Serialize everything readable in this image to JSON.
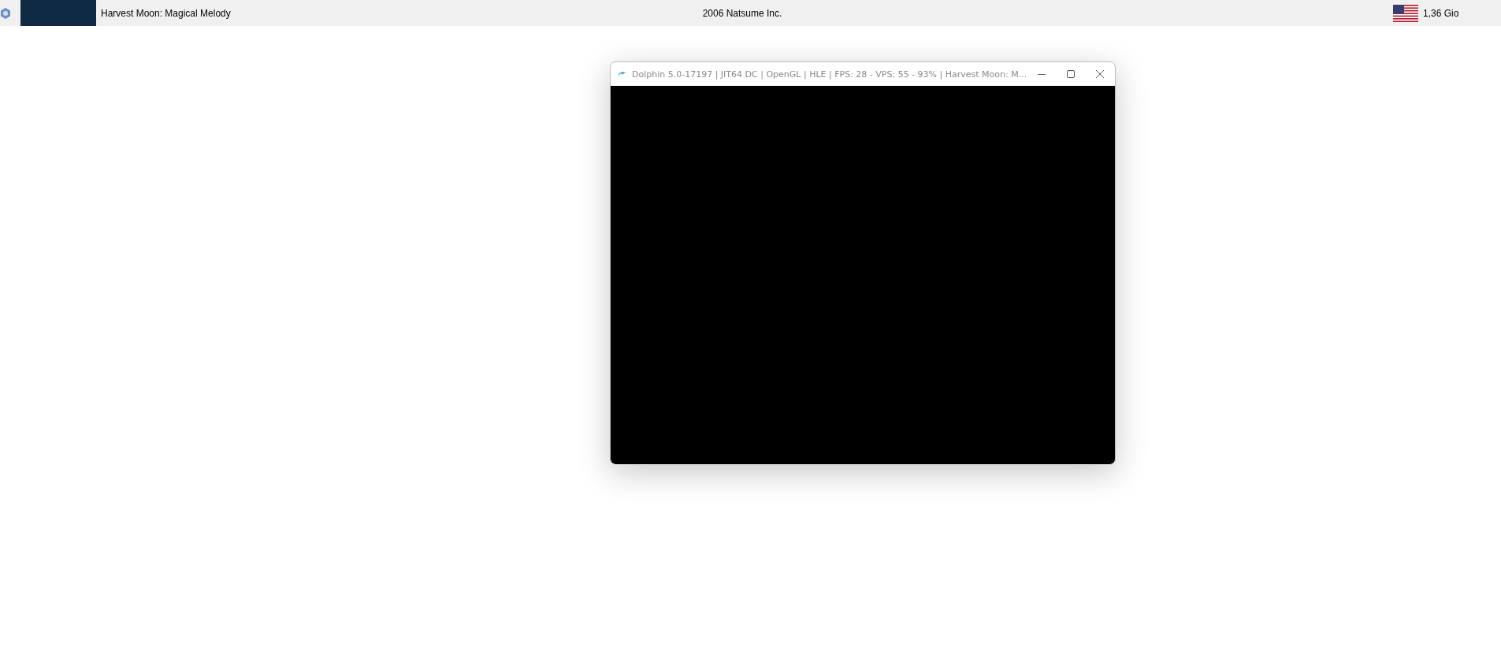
{
  "game_row": {
    "title": "Harvest Moon: Magical Melody",
    "maker": "2006 Natsume Inc.",
    "size": "1,36 Gio"
  },
  "window": {
    "title": "Dolphin 5.0-17197 | JIT64 DC | OpenGL | HLE | FPS: 28 - VPS: 55 - 93% | Harvest Moon: M..."
  }
}
